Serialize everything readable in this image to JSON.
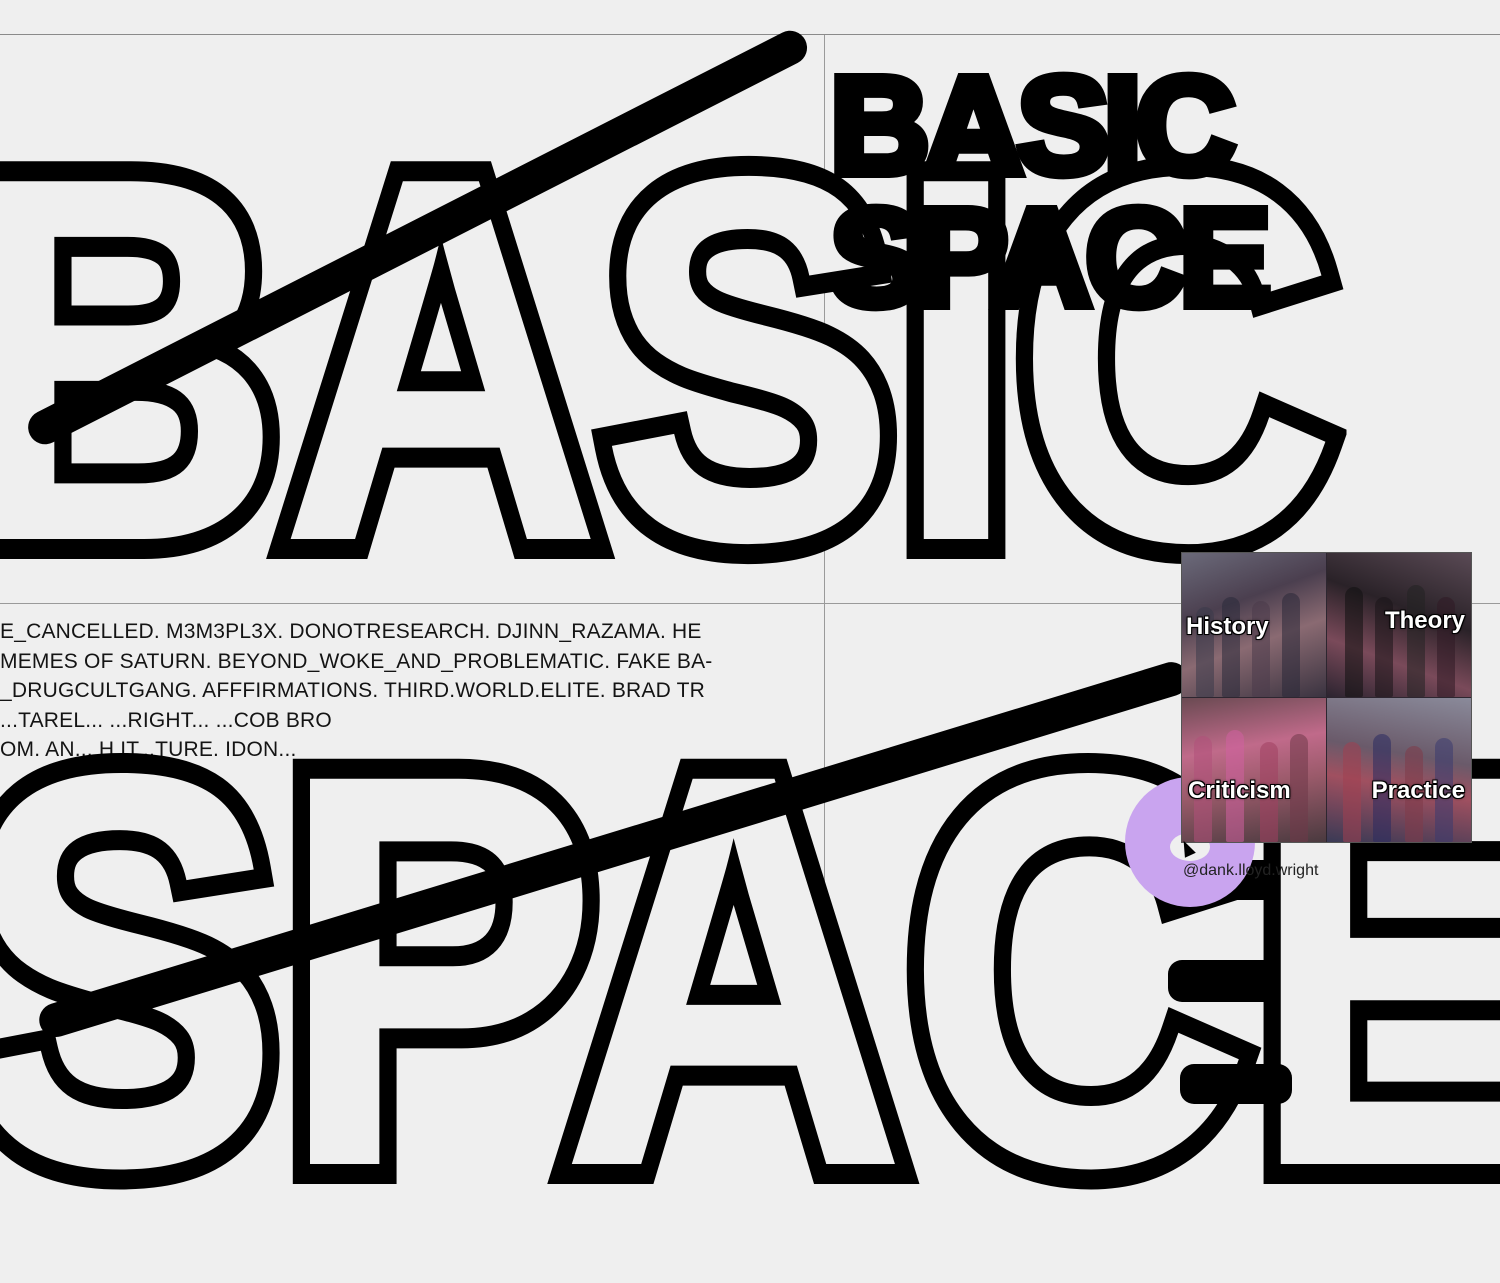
{
  "ticker": {
    "lines": [
      "E_CANCELLED. M3M3PL3X. DONOTRESEARCH. DJINN_RAZAMA. HE",
      "MEMES OF SATURN. BEYOND_WOKE_AND_PROBLEMATIC. FAKE BA-",
      "_DRUGCULTGANG. AFFFIRMATIONS. THIRD.WORLD.ELITE. BRAD TR",
      "...TAREL... ...RIGHT... ...COB BRO",
      "OM. AN... H.IT...TURE. IDON..."
    ]
  },
  "headline": {
    "line1": "BASIC",
    "line2": "SPACE"
  },
  "logo": {
    "line1": "BASIC",
    "line2": "SPACE"
  },
  "panel": {
    "tiles": [
      {
        "label": "History"
      },
      {
        "label": "Theory"
      },
      {
        "label": "Criticism"
      },
      {
        "label": "Practice"
      }
    ],
    "credit": "@dank.lloyd.wright"
  },
  "colors": {
    "background": "#efefef",
    "ink": "#000000",
    "cursor_ring": "#c9a4ef"
  }
}
